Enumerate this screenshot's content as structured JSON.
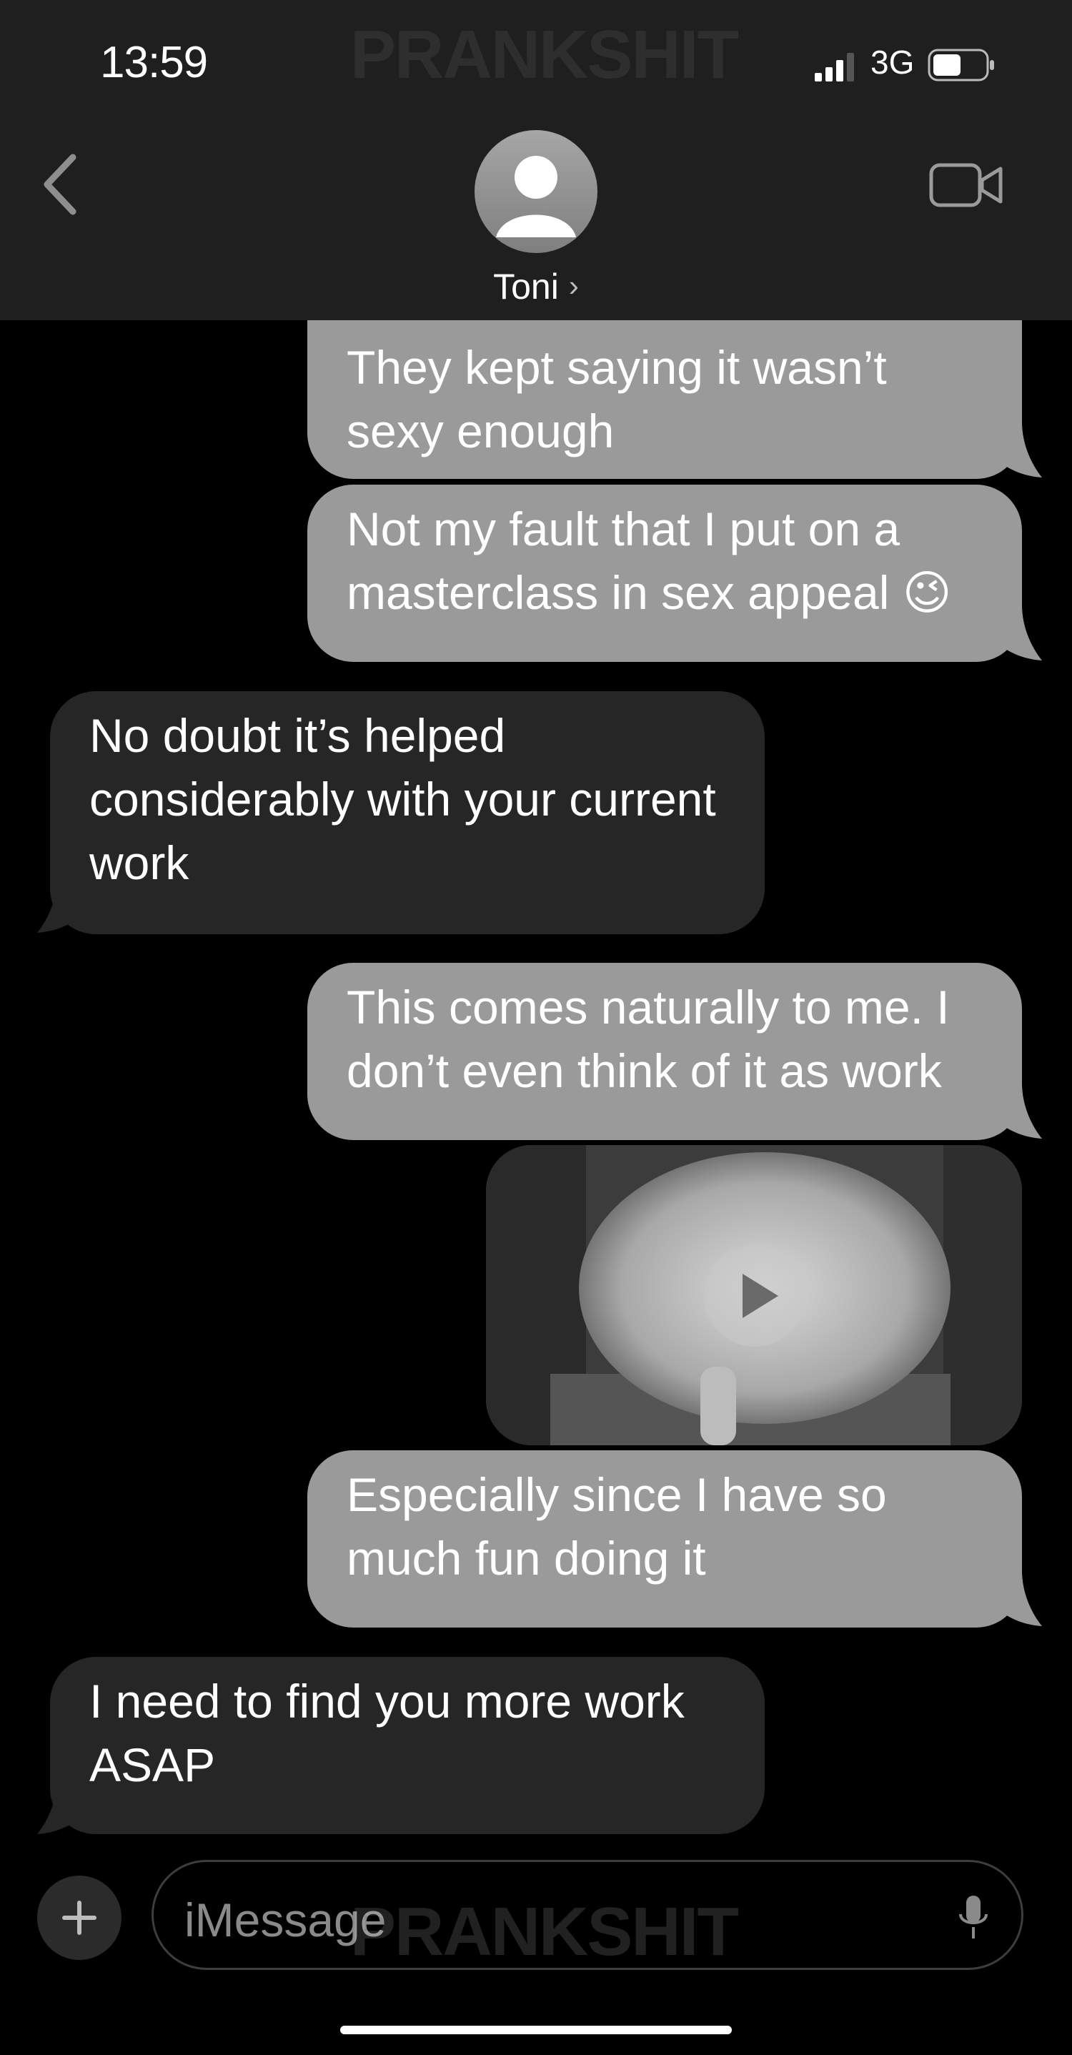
{
  "status_bar": {
    "time": "13:59",
    "network": "3G"
  },
  "watermark": "PRANKSHIT",
  "header": {
    "contact_name": "Toni",
    "contact_chevron": "›"
  },
  "messages": [
    {
      "direction": "sent",
      "text": "They kept saying it wasn’t sexy enough"
    },
    {
      "direction": "sent",
      "text": "Not my fault that I put on a masterclass in sex appeal 😉"
    },
    {
      "direction": "received",
      "text": "No doubt it’s helped considerably with your current work"
    },
    {
      "direction": "sent",
      "text": "This comes naturally to me. I don’t even think of it as work"
    },
    {
      "direction": "sent",
      "type": "video",
      "icon": "play-icon"
    },
    {
      "direction": "sent",
      "text": "Especially since I have so much fun doing it"
    },
    {
      "direction": "received",
      "text": "I need to find you more work ASAP"
    }
  ],
  "composer": {
    "placeholder": "iMessage",
    "icons": [
      "plus-icon",
      "mic-icon"
    ]
  },
  "icons": [
    "back-chevron-icon",
    "avatar-icon",
    "video-call-icon",
    "signal-icon",
    "battery-icon"
  ],
  "colors": {
    "header_bg": "#1f1f1f",
    "sent_bubble": "#9a9a9a",
    "received_bubble": "#262626",
    "background": "#000000"
  }
}
